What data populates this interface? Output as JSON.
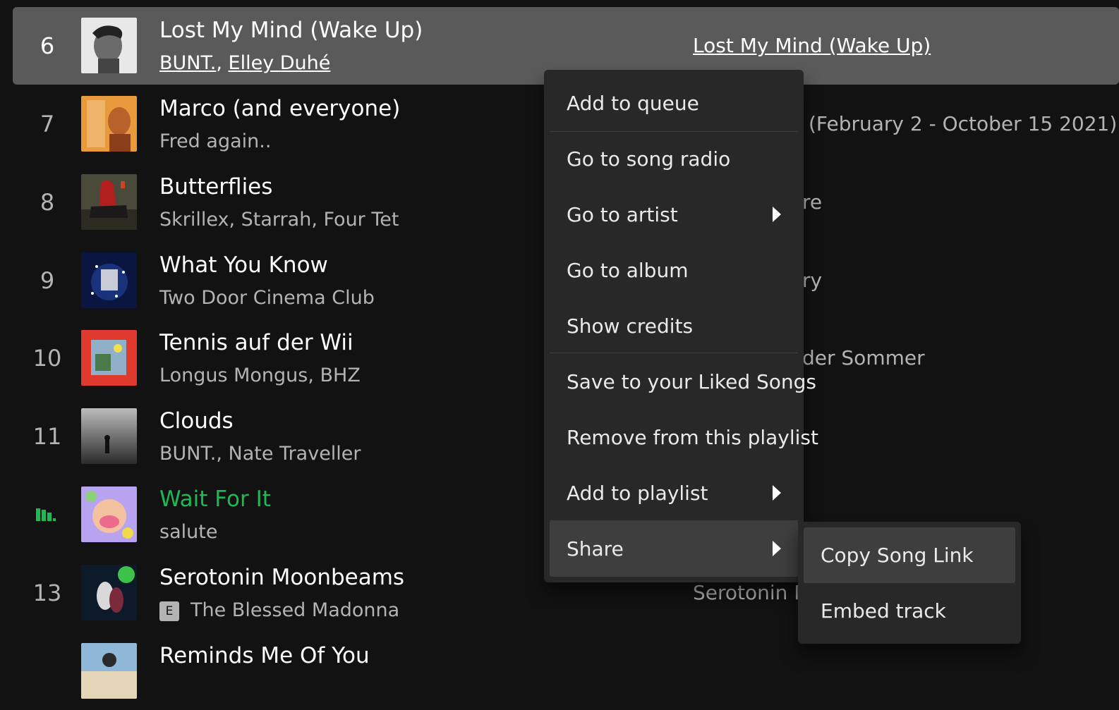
{
  "colors": {
    "background": "#121212",
    "selected_row": "#5a5a5a",
    "menu": "#282828",
    "accent": "#1db954"
  },
  "tracks": [
    {
      "number": "6",
      "title": "Lost My Mind (Wake Up)",
      "artists": [
        "BUNT.",
        "Elley Duhé"
      ],
      "album": "Lost My Mind (Wake Up)"
    },
    {
      "number": "7",
      "title": "Marco (and everyone)",
      "artists_text": "Fred again..",
      "album": "(February 2 - October 15 2021)"
    },
    {
      "number": "8",
      "title": "Butterflies",
      "artists_text": "Skrillex, Starrah, Four Tet",
      "album": "re"
    },
    {
      "number": "9",
      "title": "What You Know",
      "artists_text": "Two Door Cinema Club",
      "album": "ry"
    },
    {
      "number": "10",
      "title": "Tennis auf der Wii",
      "artists_text": "Longus Mongus, BHZ",
      "album": "der Sommer"
    },
    {
      "number": "11",
      "title": "Clouds",
      "artists_text": "BUNT., Nate Traveller",
      "album": ""
    },
    {
      "number": "",
      "title": "Wait For It",
      "artists_text": "salute",
      "album": "",
      "playing_icon": "equalizer-icon"
    },
    {
      "number": "13",
      "title": "Serotonin Moonbeams",
      "explicit": "E",
      "artists_text": "The Blessed Madonna",
      "album": "Serotonin M"
    },
    {
      "number": "",
      "title": "Reminds Me Of You"
    }
  ],
  "context_menu": {
    "items": [
      "Add to queue",
      "Go to song radio",
      "Go to artist",
      "Go to album",
      "Show credits",
      "Save to your Liked Songs",
      "Remove from this playlist",
      "Add to playlist",
      "Share"
    ]
  },
  "share_submenu": {
    "items": [
      "Copy Song Link",
      "Embed track"
    ]
  }
}
